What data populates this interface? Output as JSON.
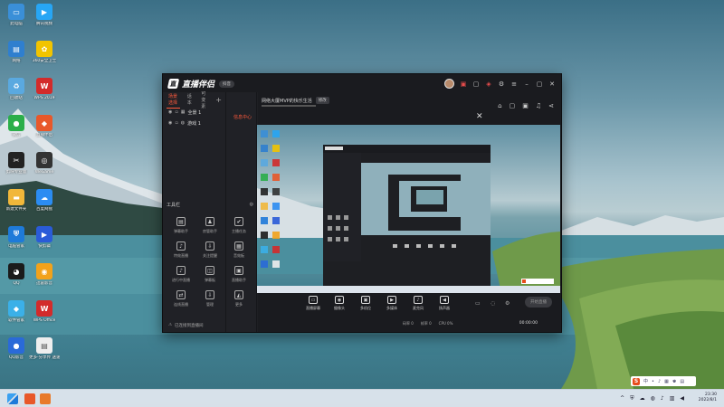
{
  "desktop": {
    "icons": [
      {
        "label": "此电脑",
        "name": "this-pc",
        "color": "#3a8fd8",
        "glyph": "▭"
      },
      {
        "label": "腾讯视频",
        "name": "tencent-video",
        "color": "#27a6f5",
        "glyph": "▶"
      },
      {
        "label": "网络",
        "name": "network",
        "color": "#2f7fcf",
        "glyph": "▤"
      },
      {
        "label": "360安全卫士",
        "name": "security-guard",
        "color": "#f2c400",
        "glyph": "✿"
      },
      {
        "label": "回收站",
        "name": "recycle-bin",
        "color": "#5aa9e0",
        "glyph": "♻"
      },
      {
        "label": "WPS 2019",
        "name": "wps-2019",
        "color": "#d32b2b",
        "glyph": "W"
      },
      {
        "label": "微信",
        "name": "wechat",
        "color": "#2bae4a",
        "glyph": "●"
      },
      {
        "label": "直播伴侣",
        "name": "live-companion",
        "color": "#e8582a",
        "glyph": "◆"
      },
      {
        "label": "剪映专业版",
        "name": "capcut",
        "color": "#222222",
        "glyph": "✂"
      },
      {
        "label": "WeGame",
        "name": "wegame",
        "color": "#333333",
        "glyph": "◎"
      },
      {
        "label": "新建文件夹",
        "name": "new-folder",
        "color": "#f1b73a",
        "glyph": "▬"
      },
      {
        "label": "百度网盘",
        "name": "baidu-netdisk",
        "color": "#2b8cf2",
        "glyph": "☁"
      },
      {
        "label": "电脑管家",
        "name": "pc-manager",
        "color": "#1e7ad9",
        "glyph": "⛨"
      },
      {
        "label": "快剪辑",
        "name": "quick-edit",
        "color": "#2a5bd8",
        "glyph": "▶"
      },
      {
        "label": "QQ",
        "name": "qq",
        "color": "#1b1b1b",
        "glyph": "◕"
      },
      {
        "label": "迅雷影音",
        "name": "thunder-player",
        "color": "#f2a21b",
        "glyph": "◉"
      },
      {
        "label": "软件管家",
        "name": "software-manager",
        "color": "#3bb0e8",
        "glyph": "◆"
      },
      {
        "label": "WPS Office",
        "name": "wps-office",
        "color": "#d32b2b",
        "glyph": "W"
      },
      {
        "label": "QQ影音",
        "name": "qq-player",
        "color": "#2a6ad8",
        "glyph": "●"
      },
      {
        "label": "更多-分享传\n送速下载器",
        "name": "downloader",
        "color": "#eeeeee",
        "glyph": "▤"
      }
    ]
  },
  "app": {
    "brand": "直播伴侣",
    "version_pill": "抖音",
    "tabs": [
      "场景选择",
      "话本",
      "可变素"
    ],
    "scenes": [
      "全景 1",
      "游戏 1"
    ],
    "message_tab": "信息中心",
    "room_title": "网络大厦MVP的快乐生活",
    "edit_label": "修改",
    "tools_title": "工具栏",
    "tools": [
      {
        "label": "弹幕助手",
        "glyph": "▤"
      },
      {
        "label": "房管助手",
        "glyph": "♟"
      },
      {
        "label": "主播任务",
        "glyph": "✔"
      },
      {
        "label": "特效直播",
        "glyph": "♪"
      },
      {
        "label": "关注提醒",
        "glyph": "⇩"
      },
      {
        "label": "音效板",
        "glyph": "▦"
      },
      {
        "label": "进行中直播",
        "glyph": "♪"
      },
      {
        "label": "弹幕板",
        "glyph": "◫"
      },
      {
        "label": "直播助手",
        "glyph": "▣"
      },
      {
        "label": "连线直播",
        "glyph": "⇄"
      },
      {
        "label": "管理",
        "glyph": "⇩"
      },
      {
        "label": "更多",
        "glyph": "◭"
      }
    ],
    "status_text": "已连接到直播间",
    "controls": [
      {
        "label": "直播屏幕",
        "glyph": "▭"
      },
      {
        "label": "摄像头",
        "glyph": "◉"
      },
      {
        "label": "多机位",
        "glyph": "▣"
      },
      {
        "label": "多媒体",
        "glyph": "▶"
      },
      {
        "label": "麦克风",
        "glyph": "♪"
      },
      {
        "label": "扬声器",
        "glyph": "◀"
      }
    ],
    "start_label": "开始直播",
    "stats": [
      "码率 0",
      "帧率 0",
      "CPU 0%"
    ],
    "timer": "00:00:00"
  },
  "taskbar": {
    "time": "23:30",
    "date": "2022/8/1"
  }
}
